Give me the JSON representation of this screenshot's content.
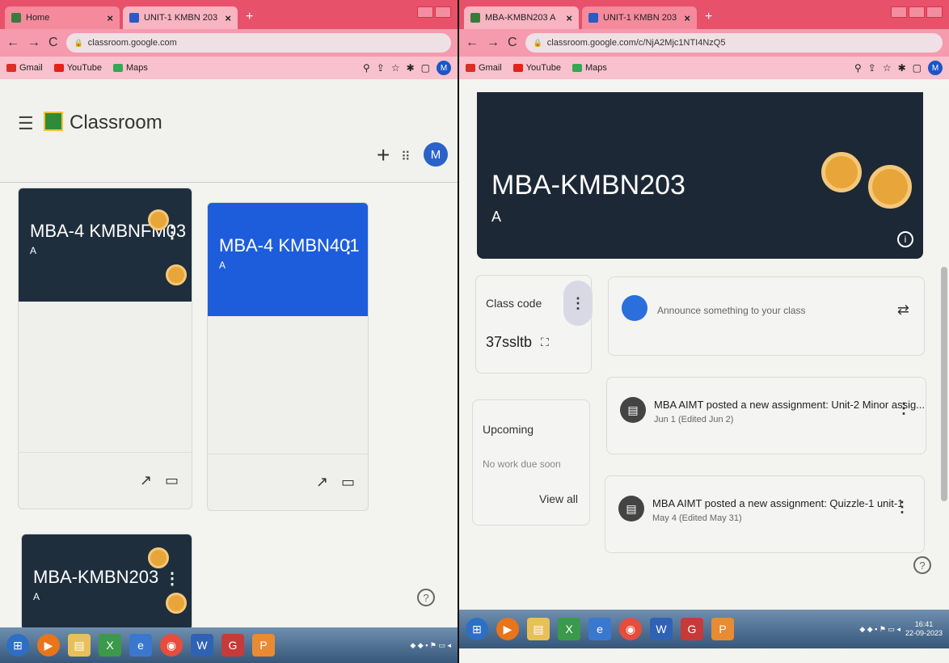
{
  "left": {
    "tabs": [
      {
        "label": "Home",
        "icon": "home-icon"
      },
      {
        "label": "UNIT-1 KMBN 203",
        "icon": "doc-icon"
      }
    ],
    "address": "classroom.google.com",
    "bookmarks": [
      "Gmail",
      "YouTube",
      "Maps"
    ],
    "profile_initial": "M",
    "app_title": "Classroom",
    "add_icon": "+",
    "apps_icon": "apps-grid-icon",
    "avatar_initial": "M",
    "courses": [
      {
        "name": "MBA-4 KMBNFM03",
        "section": "A",
        "color": "#1e2e3d"
      },
      {
        "name": "MBA-4 KMBN401",
        "section": "A",
        "color": "#1d5ddc"
      },
      {
        "name": "MBA-KMBN203",
        "section": "A",
        "color": "#1e2e3d"
      }
    ],
    "help": "?"
  },
  "right": {
    "tabs": [
      {
        "label": "MBA-KMBN203 A",
        "icon": "doc-icon"
      },
      {
        "label": "UNIT-1 KMBN 203",
        "icon": "doc-icon"
      }
    ],
    "address": "classroom.google.com/c/NjA2Mjc1NTI4NzQ5",
    "bookmarks": [
      "Gmail",
      "YouTube",
      "Maps"
    ],
    "profile_initial": "M",
    "class_title": "MBA-KMBN203",
    "class_section": "A",
    "class_code_label": "Class code",
    "class_code": "37ssltb",
    "upcoming_label": "Upcoming",
    "upcoming_status": "No work due soon",
    "view_all": "View all",
    "announce_placeholder": "Announce something to your class",
    "posts": [
      {
        "title": "MBA AIMT posted a new assignment: Unit-2 Minor assig...",
        "date": "Jun 1 (Edited Jun 2)"
      },
      {
        "title": "MBA AIMT posted a new assignment: Quizzle-1 unit-1",
        "date": "May 4 (Edited May 31)"
      }
    ],
    "help": "?",
    "clock_time": "16:41",
    "clock_date": "22-09-2023"
  },
  "colors": {
    "tabbar": "#e7516a",
    "classroom_green": "#2e8b3a",
    "dark_banner": "#1e2e3d",
    "blue_banner": "#1d5ddc"
  }
}
